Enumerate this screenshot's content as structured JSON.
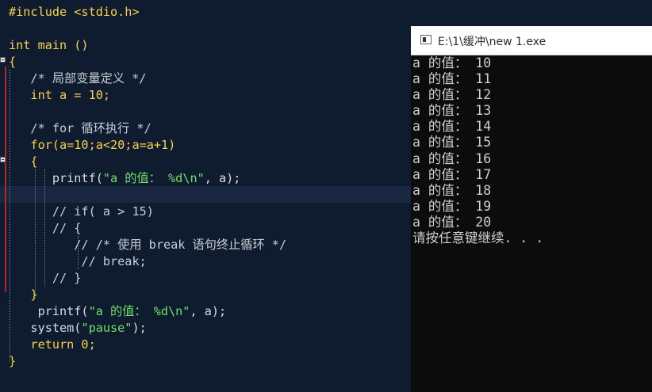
{
  "editor": {
    "lines": [
      [
        [
          "pp",
          "#include <stdio.h>"
        ]
      ],
      [],
      [
        [
          "kw",
          "int main ()"
        ]
      ],
      [
        [
          "kw",
          "{"
        ]
      ],
      [
        [
          "cmt",
          "   /* 局部变量定义 */"
        ]
      ],
      [
        [
          "kw",
          "   int a = 10;"
        ]
      ],
      [],
      [
        [
          "cmt",
          "   /* for 循环执行 */"
        ]
      ],
      [
        [
          "kw",
          "   for(a=10;a<20;a=a+1)"
        ]
      ],
      [
        [
          "kw",
          "   {"
        ]
      ],
      [
        [
          "",
          "      printf("
        ],
        [
          "str",
          "\"a 的值： %d\\n\""
        ],
        [
          "",
          ", a);"
        ]
      ],
      [],
      [
        [
          "cmt",
          "      // if( a > 15)"
        ]
      ],
      [
        [
          "cmt",
          "      // {"
        ]
      ],
      [
        [
          "cmt",
          "         // /* 使用 break 语句终止循环 */"
        ]
      ],
      [
        [
          "cmt",
          "          // break;"
        ]
      ],
      [
        [
          "cmt",
          "      // }"
        ]
      ],
      [
        [
          "kw",
          "   }"
        ]
      ],
      [
        [
          "",
          "    printf("
        ],
        [
          "str",
          "\"a 的值： %d\\n\""
        ],
        [
          "",
          ", a);"
        ]
      ],
      [
        [
          "",
          "   system("
        ],
        [
          "str",
          "\"pause\""
        ],
        [
          "",
          ");"
        ]
      ],
      [
        [
          "kw",
          "   return 0;"
        ]
      ],
      [
        [
          "kw",
          "}"
        ]
      ]
    ]
  },
  "console": {
    "title": "E:\\1\\缓冲\\new 1.exe",
    "output": [
      "a 的值： 10",
      "a 的值： 11",
      "a 的值： 12",
      "a 的值： 13",
      "a 的值： 14",
      "a 的值： 15",
      "a 的值： 16",
      "a 的值： 17",
      "a 的值： 18",
      "a 的值： 19",
      "a 的值： 20",
      "请按任意键继续. . ."
    ]
  }
}
